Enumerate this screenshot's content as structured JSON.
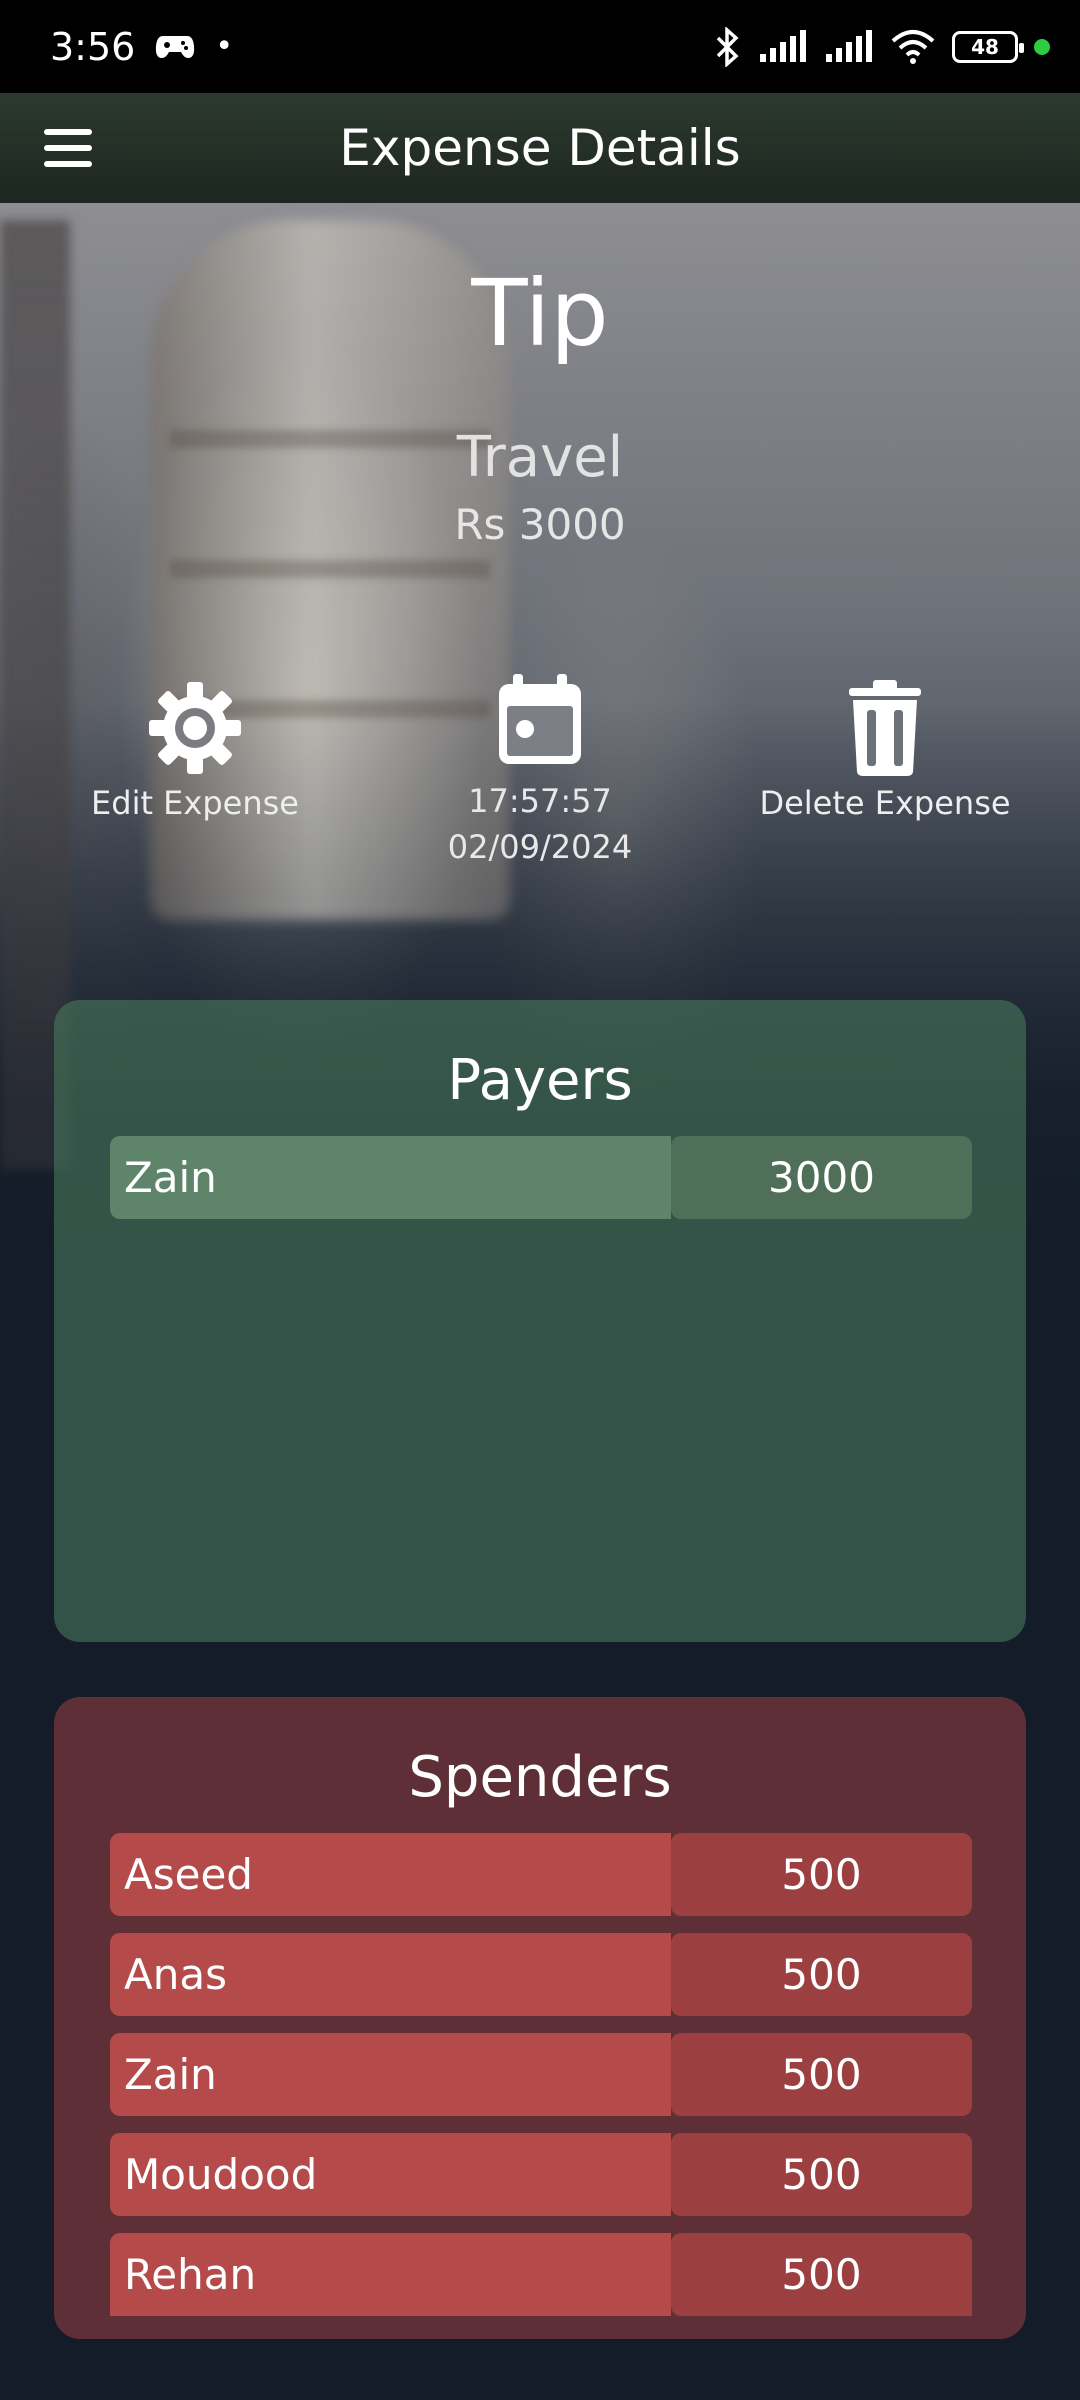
{
  "status_bar": {
    "time": "3:56",
    "battery": "48"
  },
  "app_bar": {
    "title": "Expense Details"
  },
  "expense": {
    "name": "Tip",
    "category": "Travel",
    "amount": "Rs 3000",
    "time": "17:57:57",
    "date": "02/09/2024"
  },
  "actions": {
    "edit_label": "Edit Expense",
    "delete_label": "Delete Expense"
  },
  "payers": {
    "title": "Payers",
    "rows": [
      {
        "name": "Zain",
        "amount": "3000"
      }
    ]
  },
  "spenders": {
    "title": "Spenders",
    "rows": [
      {
        "name": "Aseed",
        "amount": "500"
      },
      {
        "name": "Anas",
        "amount": "500"
      },
      {
        "name": "Zain",
        "amount": "500"
      },
      {
        "name": "Moudood",
        "amount": "500"
      },
      {
        "name": "Rehan",
        "amount": "500"
      }
    ]
  },
  "colors": {
    "payer_row": "#5e846a",
    "spender_row": "#b54a4a",
    "spender_panel": "#5e2f36"
  }
}
